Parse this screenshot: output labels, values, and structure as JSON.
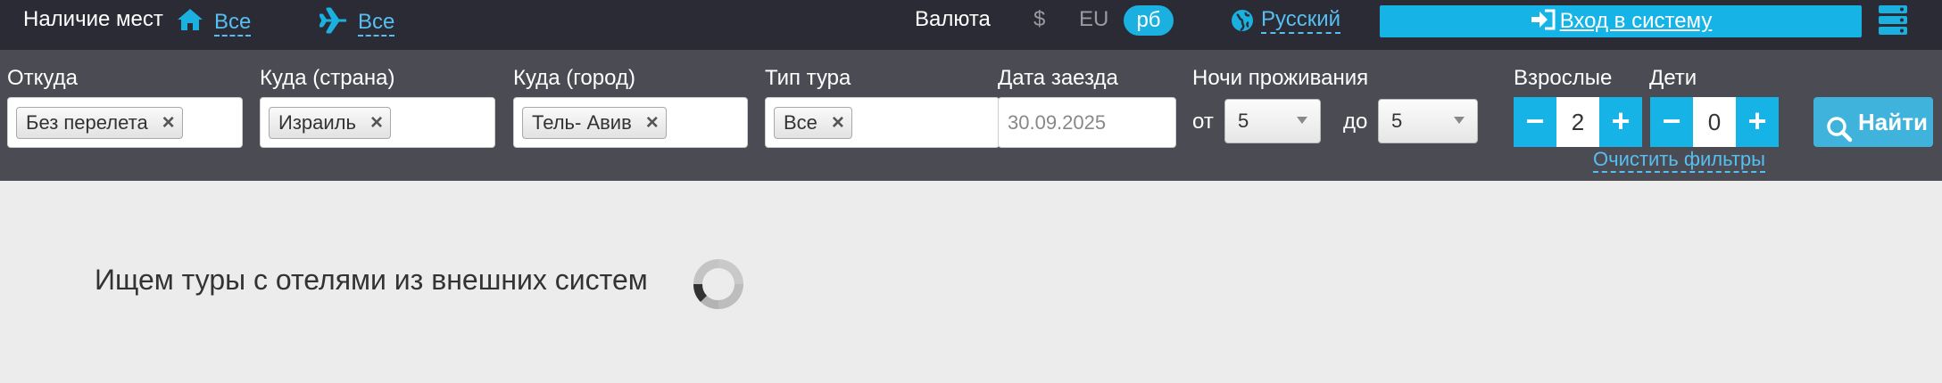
{
  "topbar": {
    "availability_label": "Наличие мест",
    "availability_all_hotels": "Все",
    "availability_all_flights": "Все",
    "currency_label": "Валюта",
    "currencies": [
      "$",
      "EU",
      "рб"
    ],
    "active_currency": "рб",
    "language": "Русский",
    "login_label": "Вход в систему",
    "icons": [
      "home-icon",
      "plane-icon",
      "globe-icon",
      "login-icon",
      "menu-icon"
    ]
  },
  "filters": {
    "from": {
      "label": "Откуда",
      "tag": "Без перелета"
    },
    "to_country": {
      "label": "Куда (страна)",
      "tag": "Израиль"
    },
    "to_city": {
      "label": "Куда (город)",
      "tag": "Тель- Авив"
    },
    "tour_type": {
      "label": "Тип тура",
      "tag": "Все"
    },
    "checkin": {
      "label": "Дата заезда",
      "value": "30.09.2025"
    },
    "nights": {
      "label": "Ночи проживания",
      "from_label": "от",
      "from_value": "5",
      "to_label": "до",
      "to_value": "5"
    },
    "adults": {
      "label": "Взрослые",
      "value": "2",
      "minus": "−",
      "plus": "+"
    },
    "children": {
      "label": "Дети",
      "value": "0",
      "minus": "−",
      "plus": "+"
    },
    "clear_label": "Очистить фильтры",
    "search_label": "Найти",
    "remove_symbol": "×"
  },
  "content": {
    "status_text": "Ищем туры с отелями из внешних систем"
  },
  "colors": {
    "topbar_bg": "#2b2b36",
    "filterbar_bg": "#4b4b54",
    "accent": "#16b4e6",
    "link": "#56bff0",
    "page_bg": "#ececec"
  }
}
